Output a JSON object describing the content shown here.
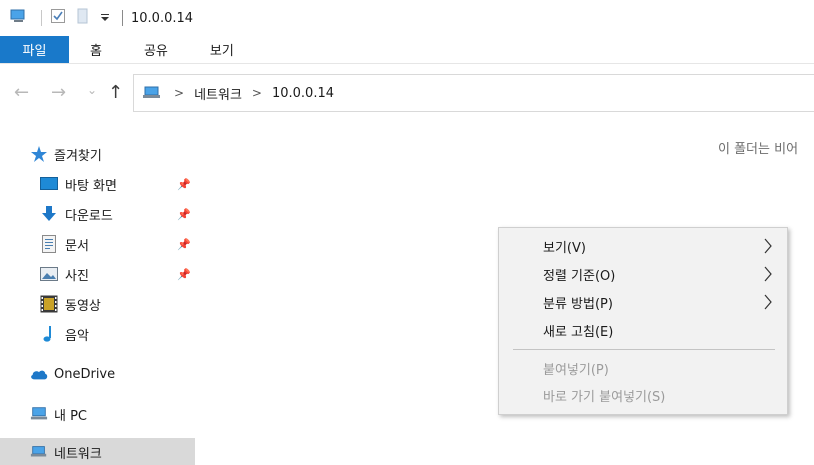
{
  "window": {
    "title": "10.0.0.14"
  },
  "quick_access_toolbar": {
    "icons": [
      "computer-icon",
      "properties-checkbox-icon",
      "new-folder-icon",
      "customize-dropdown-icon"
    ]
  },
  "ribbon": {
    "tabs": [
      {
        "label": "파일",
        "active": true
      },
      {
        "label": "홈"
      },
      {
        "label": "공유"
      },
      {
        "label": "보기"
      }
    ]
  },
  "address_bar": {
    "back": "←",
    "forward": "→",
    "recent": "⌄",
    "up": "↑",
    "breadcrumbs": [
      "네트워크",
      "10.0.0.14"
    ]
  },
  "navigation": {
    "quick_access": "즐겨찾기",
    "items": [
      {
        "label": "바탕 화면",
        "icon": "desktop-icon",
        "pinned": true
      },
      {
        "label": "다운로드",
        "icon": "download-icon",
        "pinned": true
      },
      {
        "label": "문서",
        "icon": "document-icon",
        "pinned": true
      },
      {
        "label": "사진",
        "icon": "pictures-icon",
        "pinned": true
      },
      {
        "label": "동영상",
        "icon": "video-icon",
        "pinned": false
      },
      {
        "label": "음악",
        "icon": "music-icon",
        "pinned": false
      }
    ],
    "onedrive": "OneDrive",
    "this_pc": "내 PC",
    "network": "네트워크"
  },
  "content": {
    "empty_message": "이 폴더는 비어"
  },
  "context_menu": {
    "items": [
      {
        "label": "보기(V)",
        "submenu": true,
        "enabled": true
      },
      {
        "label": "정렬 기준(O)",
        "submenu": true,
        "enabled": true
      },
      {
        "label": "분류 방법(P)",
        "submenu": true,
        "enabled": true
      },
      {
        "label": "새로 고침(E)",
        "submenu": false,
        "enabled": true
      },
      {
        "label": "붙여넣기(P)",
        "submenu": false,
        "enabled": false
      },
      {
        "label": "바로 가기 붙여넣기(S)",
        "submenu": false,
        "enabled": false
      }
    ]
  },
  "colors": {
    "accent": "#1979ca",
    "selected_bg": "#d9d9d9",
    "menu_bg": "#f2f2f2"
  }
}
